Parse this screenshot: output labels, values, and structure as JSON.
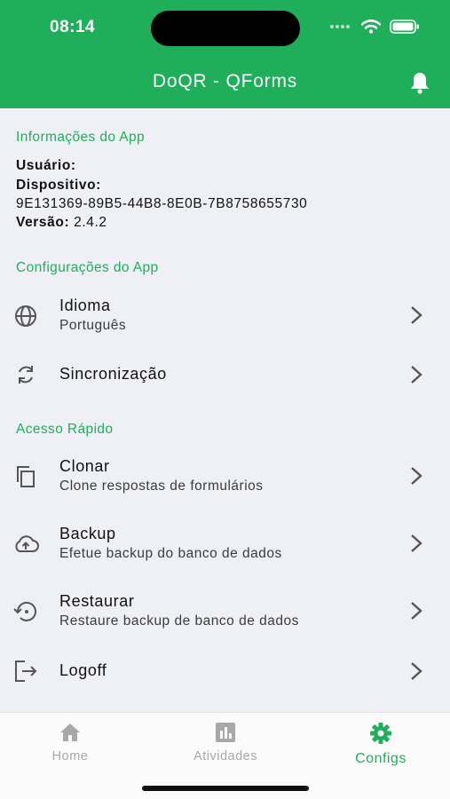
{
  "status_bar": {
    "time": "08:14"
  },
  "header": {
    "title": "DoQR - QForms"
  },
  "app_info": {
    "section_title": "Informações do App",
    "user_label": "Usuário:",
    "user_value": "",
    "device_label": "Dispositivo:",
    "device_id": "9E131369-89B5-44B8-8E0B-7B8758655730",
    "version_label": "Versão:",
    "version_value": "2.4.2"
  },
  "app_config": {
    "section_title": "Configurações do App",
    "items": [
      {
        "title": "Idioma",
        "subtitle": "Português",
        "icon": "globe-icon"
      },
      {
        "title": "Sincronização",
        "subtitle": "",
        "icon": "sync-icon"
      }
    ]
  },
  "quick_access": {
    "section_title": "Acesso Rápido",
    "items": [
      {
        "title": "Clonar",
        "subtitle": "Clone respostas de formulários",
        "icon": "copy-icon"
      },
      {
        "title": "Backup",
        "subtitle": "Efetue backup do banco de dados",
        "icon": "cloud-upload-icon"
      },
      {
        "title": "Restaurar",
        "subtitle": "Restaure backup de banco de dados",
        "icon": "restore-icon"
      },
      {
        "title": "Logoff",
        "subtitle": "",
        "icon": "logout-icon"
      }
    ]
  },
  "tabs": [
    {
      "label": "Home",
      "icon": "home-icon",
      "active": false
    },
    {
      "label": "Atividades",
      "icon": "chart-icon",
      "active": false
    },
    {
      "label": "Configs",
      "icon": "gear-icon",
      "active": true
    }
  ],
  "colors": {
    "accent": "#1fae5a",
    "background": "#eff0f5",
    "inactive_tab": "#a8a8a8"
  }
}
